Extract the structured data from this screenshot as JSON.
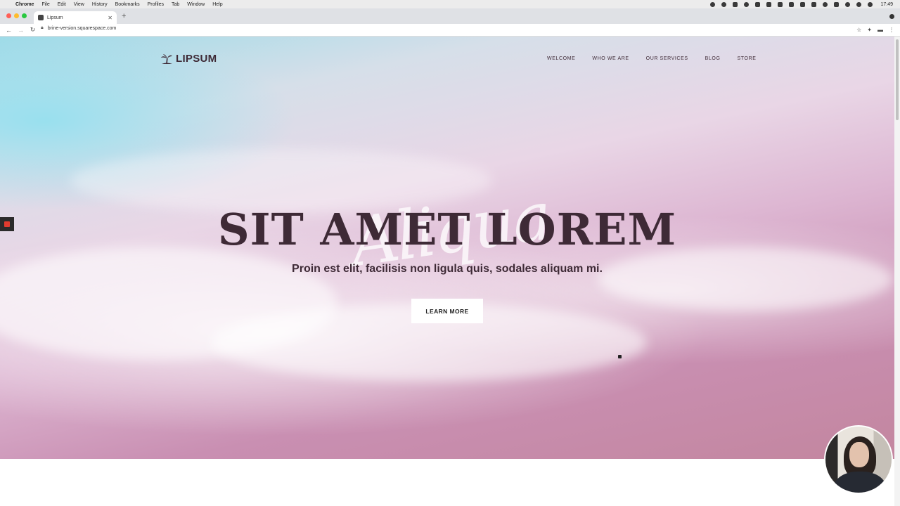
{
  "menubar": {
    "app": "Chrome",
    "items": [
      "File",
      "Edit",
      "View",
      "History",
      "Bookmarks",
      "Profiles",
      "Tab",
      "Window",
      "Help"
    ],
    "clock": "17:49"
  },
  "browser": {
    "tab_title": "Lipsum",
    "url": "brine-version.squarespace.com"
  },
  "site": {
    "logo": "LIPSUM",
    "nav": [
      "WELCOME",
      "WHO WE ARE",
      "OUR SERVICES",
      "BLOG",
      "STORE"
    ],
    "script_overlay": "Aliqua",
    "headline": "SIT AMET LOREM",
    "subheadline": "Proin est elit, facilisis non ligula quis, sodales aliquam mi.",
    "cta": "LEARN MORE"
  },
  "colors": {
    "text_dark": "#3e2a36",
    "record_indicator": "#e03b2f"
  }
}
